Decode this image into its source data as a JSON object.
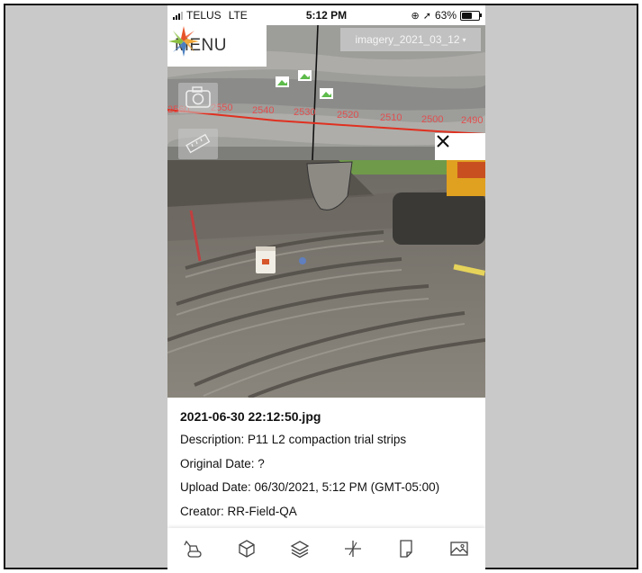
{
  "status_bar": {
    "carrier": "TELUS",
    "network": "LTE",
    "time": "5:12 PM",
    "battery": "63%",
    "battery_level": 0.63
  },
  "map": {
    "menu_label": "MENU",
    "imagery_select": "imagery_2021_03_12",
    "chainage_labels": [
      "2560",
      "2550",
      "2540",
      "2530",
      "2520",
      "2510",
      "2500",
      "2490"
    ],
    "line_color": "#e03020",
    "chainage_color": "#e05050"
  },
  "photo": {
    "filename": "2021-06-30 22:12:50.jpg",
    "description": "Description: P11 L2 compaction trial strips",
    "original_date": "Original Date: ?",
    "upload_date": "Upload Date: 06/30/2021, 5:12 PM (GMT-05:00)",
    "creator": "Creator: RR-Field-QA"
  },
  "toolbar": {
    "icons": [
      "excavator-icon",
      "cube-icon",
      "layers-icon",
      "measure-icon",
      "document-icon",
      "image-icon"
    ]
  }
}
